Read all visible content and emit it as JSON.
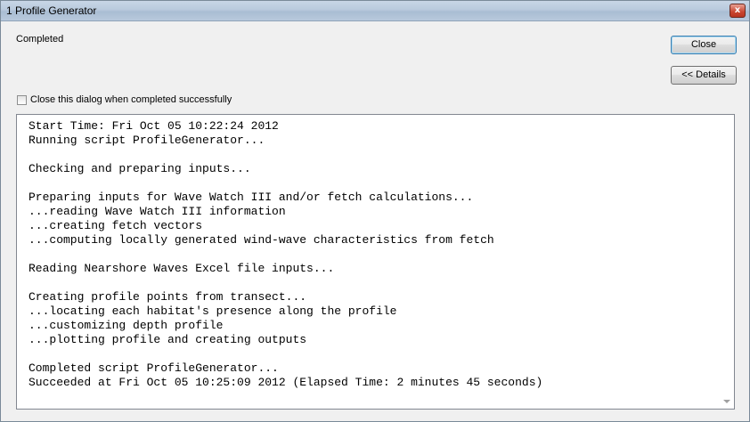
{
  "window": {
    "title": "1 Profile Generator",
    "close_glyph": "x"
  },
  "status_text": "Completed",
  "buttons": {
    "close_label": "Close",
    "details_label": "<< Details"
  },
  "checkbox": {
    "label": "Close this dialog when completed successfully",
    "checked": false
  },
  "log": {
    "lines": [
      "Start Time: Fri Oct 05 10:22:24 2012",
      "Running script ProfileGenerator...",
      "",
      "Checking and preparing inputs...",
      "",
      "Preparing inputs for Wave Watch III and/or fetch calculations...",
      "...reading Wave Watch III information",
      "...creating fetch vectors",
      "...computing locally generated wind-wave characteristics from fetch",
      "",
      "Reading Nearshore Waves Excel file inputs...",
      "",
      "Creating profile points from transect...",
      "...locating each habitat's presence along the profile",
      "...customizing depth profile",
      "...plotting profile and creating outputs",
      "",
      "Completed script ProfileGenerator...",
      "Succeeded at Fri Oct 05 10:25:09 2012 (Elapsed Time: 2 minutes 45 seconds)"
    ]
  }
}
